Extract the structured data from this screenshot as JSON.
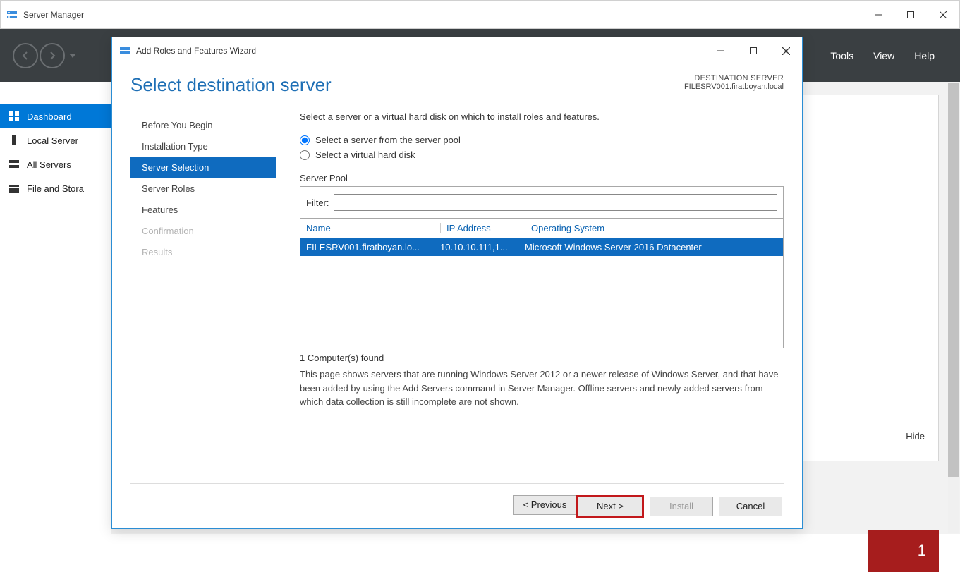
{
  "window": {
    "title": "Server Manager",
    "controls": {
      "close": "✕"
    }
  },
  "toolbar": {
    "menu": {
      "tools": "Tools",
      "view": "View",
      "help": "Help"
    }
  },
  "sidebar": {
    "items": [
      {
        "label": "Dashboard"
      },
      {
        "label": "Local Server"
      },
      {
        "label": "All Servers"
      },
      {
        "label": "File and Stora"
      }
    ]
  },
  "content": {
    "hide": "Hide",
    "red_tile_count": "1"
  },
  "dialog": {
    "title": "Add Roles and Features Wizard",
    "heading": "Select destination server",
    "dest_label": "DESTINATION SERVER",
    "dest_server": "FILESRV001.firatboyan.local",
    "steps": [
      {
        "label": "Before You Begin"
      },
      {
        "label": "Installation Type"
      },
      {
        "label": "Server Selection"
      },
      {
        "label": "Server Roles"
      },
      {
        "label": "Features"
      },
      {
        "label": "Confirmation"
      },
      {
        "label": "Results"
      }
    ],
    "instruction": "Select a server or a virtual hard disk on which to install roles and features.",
    "radio1": "Select a server from the server pool",
    "radio2": "Select a virtual hard disk",
    "pool_label": "Server Pool",
    "filter_label": "Filter:",
    "filter_value": "",
    "columns": {
      "name": "Name",
      "ip": "IP Address",
      "os": "Operating System"
    },
    "rows": [
      {
        "name": "FILESRV001.firatboyan.lo...",
        "ip": "10.10.10.111,1...",
        "os": "Microsoft Windows Server 2016 Datacenter"
      }
    ],
    "count": "1 Computer(s) found",
    "description": "This page shows servers that are running Windows Server 2012 or a newer release of Windows Server, and that have been added by using the Add Servers command in Server Manager. Offline servers and newly-added servers from which data collection is still incomplete are not shown.",
    "buttons": {
      "previous": "< Previous",
      "next": "Next >",
      "install": "Install",
      "cancel": "Cancel"
    }
  }
}
